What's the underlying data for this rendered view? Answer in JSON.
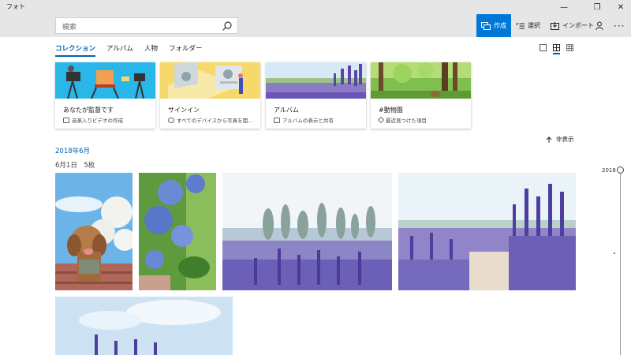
{
  "app": {
    "title": "フォト"
  },
  "window": {
    "minimize": "—",
    "maximize": "❐",
    "close": "✕"
  },
  "search": {
    "placeholder": "検索"
  },
  "toolbar": {
    "create_label": "作成",
    "select_label": "選択",
    "import_label": "インポート",
    "more_label": "···"
  },
  "tabs": [
    "コレクション",
    "アルバム",
    "人物",
    "フォルダー"
  ],
  "cards": [
    {
      "title": "あなたが監督です",
      "subtitle": "音楽入りビデオの作成"
    },
    {
      "title": "サインイン",
      "subtitle": "すべてのデバイスから写真を閲..."
    },
    {
      "title": "アルバム",
      "subtitle": "アルバムの表示と共有"
    },
    {
      "title": "#動物園",
      "subtitle": "最近見つけた項目"
    }
  ],
  "hide_label": "非表示",
  "section": {
    "month": "2018年6月",
    "day": "6月1日　5枚"
  },
  "timeline": {
    "year": "2018"
  },
  "colors": {
    "accent": "#0078d7",
    "link": "#0063b1"
  }
}
